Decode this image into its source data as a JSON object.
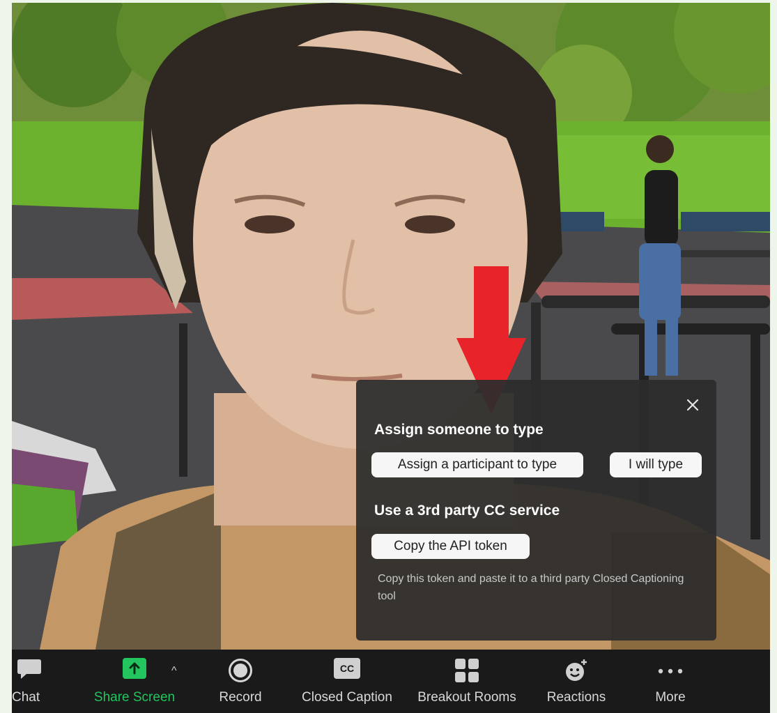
{
  "popup": {
    "section1_title": "Assign someone to type",
    "assign_participant_label": "Assign a participant to type",
    "i_will_type_label": "I will type",
    "section2_title": "Use a 3rd party CC service",
    "copy_token_label": "Copy the API token",
    "note": "Copy this token and paste it to a third party Closed Captioning tool"
  },
  "toolbar": {
    "items": [
      {
        "label": "Chat",
        "icon": "chat-bubble-icon"
      },
      {
        "label": "Share Screen",
        "icon": "share-screen-icon"
      },
      {
        "label": "Record",
        "icon": "record-icon"
      },
      {
        "label": "Closed Caption",
        "icon": "cc-icon",
        "icon_text": "CC"
      },
      {
        "label": "Breakout Rooms",
        "icon": "breakout-rooms-icon"
      },
      {
        "label": "Reactions",
        "icon": "reactions-icon"
      },
      {
        "label": "More",
        "icon": "more-dots-icon"
      }
    ],
    "caret": "^"
  },
  "colors": {
    "toolbar_bg": "#1a1a1a",
    "share_green": "#22c55e",
    "arrow_red": "#e8232a",
    "popup_bg": "#2c2c2c"
  }
}
